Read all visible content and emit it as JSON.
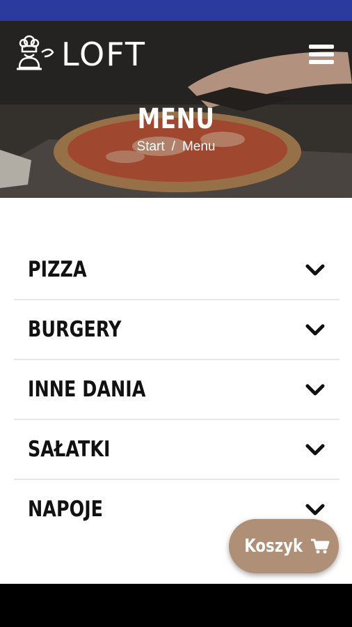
{
  "header": {
    "logo_text": "LOFT",
    "menu_icon": "hamburger-icon"
  },
  "hero": {
    "title": "MENU",
    "breadcrumb": {
      "home": "Start",
      "separator": "/",
      "current": "Menu"
    }
  },
  "categories": [
    {
      "label": "PIZZA",
      "icon": "chevron-down-icon"
    },
    {
      "label": "BURGERY",
      "icon": "chevron-down-icon"
    },
    {
      "label": "INNE DANIA",
      "icon": "chevron-down-icon"
    },
    {
      "label": "SAŁATKI",
      "icon": "chevron-down-icon"
    },
    {
      "label": "NAPOJE",
      "icon": "chevron-down-icon"
    }
  ],
  "cart": {
    "label": "Koszyk",
    "icon": "cart-icon"
  },
  "colors": {
    "status_bar": "#2b3a9e",
    "cart_button": "#b08f77",
    "text_dark": "#111111",
    "nav_bar": "#000000"
  }
}
